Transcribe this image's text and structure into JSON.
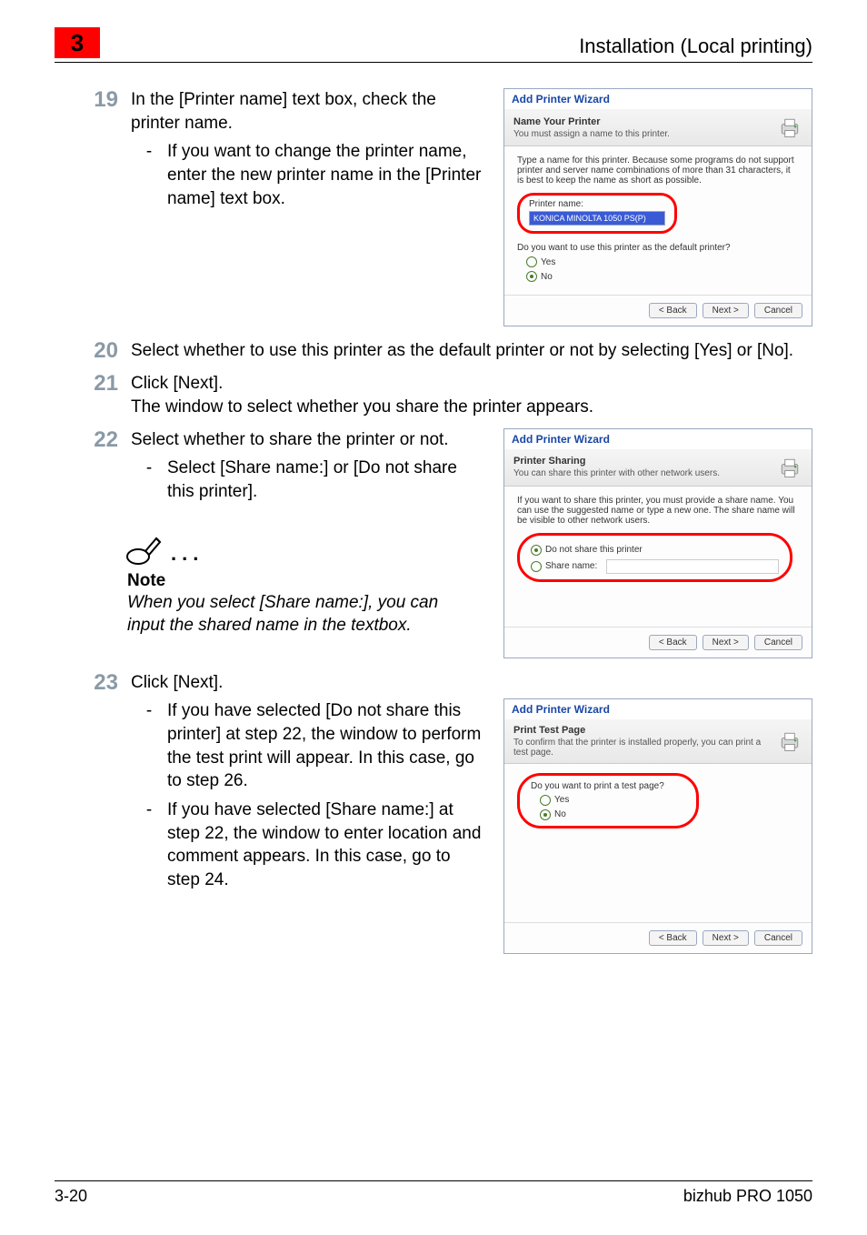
{
  "header": {
    "chapter_number": "3",
    "section_title": "Installation (Local printing)"
  },
  "steps": {
    "s19": {
      "num": "19",
      "text": "In the [Printer name] text box, check the printer name.",
      "bullet": "If you want to change the printer name, enter the new printer name in the [Printer name] text box."
    },
    "s20": {
      "num": "20",
      "text": "Select whether to use this printer as the default printer or not by selecting [Yes] or [No]."
    },
    "s21": {
      "num": "21",
      "text_a": "Click [Next].",
      "text_b": "The window to select whether you share the printer appears."
    },
    "s22": {
      "num": "22",
      "text": "Select whether to share the printer or not.",
      "bullet": "Select [Share name:] or [Do not share this printer]."
    },
    "s23": {
      "num": "23",
      "text": "Click [Next].",
      "bullet_a": "If you have selected [Do not share this printer] at step 22, the window to perform the test print will appear. In this case, go to step 26.",
      "bullet_b": "If you have selected [Share name:] at step 22, the window to enter location and comment appears. In this case, go to step 24."
    }
  },
  "note": {
    "label": "Note",
    "text": "When you select [Share name:], you can input the shared name in the textbox."
  },
  "dialogs": {
    "common_title": "Add Printer Wizard",
    "btn_back": "< Back",
    "btn_next": "Next >",
    "btn_cancel": "Cancel",
    "d1": {
      "header_title": "Name Your Printer",
      "header_sub": "You must assign a name to this printer.",
      "body_intro": "Type a name for this printer. Because some programs do not support printer and server name combinations of more than 31 characters, it is best to keep the name as short as possible.",
      "field_label": "Printer name:",
      "field_value": "KONICA MINOLTA 1050 PS(P)",
      "question": "Do you want to use this printer as the default printer?",
      "opt_yes": "Yes",
      "opt_no": "No"
    },
    "d2": {
      "header_title": "Printer Sharing",
      "header_sub": "You can share this printer with other network users.",
      "body_intro": "If you want to share this printer, you must provide a share name. You can use the suggested name or type a new one. The share name will be visible to other network users.",
      "opt_noshare": "Do not share this printer",
      "opt_share": "Share name:"
    },
    "d3": {
      "header_title": "Print Test Page",
      "header_sub": "To confirm that the printer is installed properly, you can print a test page.",
      "question": "Do you want to print a test page?",
      "opt_yes": "Yes",
      "opt_no": "No"
    }
  },
  "footer": {
    "page": "3-20",
    "product": "bizhub PRO 1050"
  }
}
